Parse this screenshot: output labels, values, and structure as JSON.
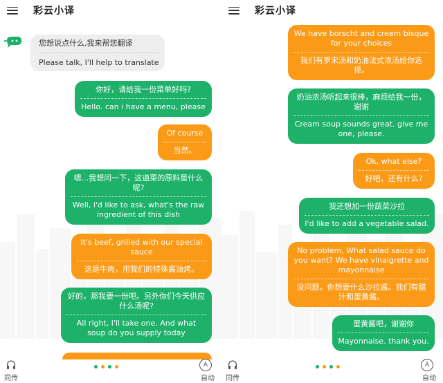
{
  "colors": {
    "green": "#1db16a",
    "orange": "#fa9a17",
    "grey": "#eeeeef"
  },
  "left": {
    "header": {
      "title": "彩云小译",
      "menu_icon": "hamburger-menu-icon"
    },
    "prompt": {
      "zh": "您想说点什么,我来帮您翻译",
      "en": "Please talk, I'll help to translate"
    },
    "messages": [
      {
        "top": "你好，请给我一份菜单好吗?",
        "bottom": "Hello. can i have a menu, please"
      },
      {
        "top": "Of course",
        "bottom": "当然。"
      },
      {
        "top": "嗯...我想问一下，这道菜的原料是什么呢?",
        "bottom": "Well, i'd like to ask, what's the raw ingredient of this dish"
      },
      {
        "top": "It's beef, grilled with our special sauce",
        "bottom": "这是牛肉，用我们的特殊酱油烤。"
      },
      {
        "top": "好的，那我要一份吧。另外你们今天供应什么汤呢?",
        "bottom": "All right, i'll take one. And what soup do you supply today"
      }
    ],
    "footer": {
      "left_label": "同传",
      "right_label": "自动",
      "auto_icon_letter": "A"
    }
  },
  "right": {
    "header": {
      "title": "彩云小译",
      "menu_icon": "hamburger-menu-icon"
    },
    "messages": [
      {
        "top": "We have borscht and cream bisque for your choices",
        "bottom": "我们有罗宋汤和奶油法式浓汤给你选择。"
      },
      {
        "top": "奶油浓汤听起来很棒，麻烦给我一份，谢谢",
        "bottom": "Cream soup sounds great. give me one, please."
      },
      {
        "top": "Ok, what else?",
        "bottom": "好吧，还有什么?"
      },
      {
        "top": "我还想加一份蔬菜沙拉",
        "bottom": "I'd like to add a vegetable salad."
      },
      {
        "top": "No problem. What salad sauce do you want?  We have vinaigrette and mayonnaise",
        "bottom": "没问题。你想要什么沙拉酱。我们有醋汁和蛋黄酱。"
      },
      {
        "top": "蛋黄酱吧，谢谢你",
        "bottom": "Mayonnaise. thank you."
      }
    ],
    "footer": {
      "left_label": "同传",
      "right_label": "自动",
      "auto_icon_letter": "A"
    }
  }
}
